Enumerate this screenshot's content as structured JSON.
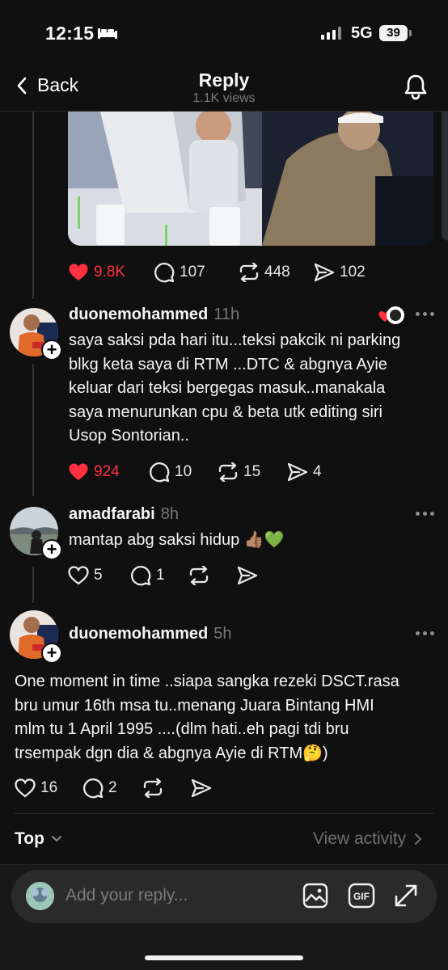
{
  "status_bar": {
    "time": "12:15",
    "network": "5G",
    "battery": "39"
  },
  "header": {
    "back_label": "Back",
    "title": "Reply",
    "views": "1.1K views"
  },
  "post_actions": {
    "likes": "9.8K",
    "comments": "107",
    "reposts": "448",
    "shares": "102"
  },
  "replies": [
    {
      "username": "duonemohammed",
      "time": "11h",
      "text": "saya saksi pda hari itu...teksi pakcik ni parking\nblkg keta saya di RTM ...DTC & abgnya Ayie\nkeluar dari teksi bergegas masuk..manakala\nsaya menurunkan cpu & beta utk editing siri\nUsop Sontorian..",
      "likes": "924",
      "comments": "10",
      "reposts": "15",
      "shares": "4"
    },
    {
      "username": "amadfarabi",
      "time": "8h",
      "text": "mantap abg saksi hidup 👍🏽💚",
      "likes": "5",
      "comments": "1",
      "reposts": "",
      "shares": ""
    },
    {
      "username": "duonemohammed",
      "time": "5h",
      "text": "One moment in time ..siapa sangka rezeki DSCT.rasa\nbru umur 16th msa tu..menang Juara Bintang HMI\nmlm tu 1 April 1995 ....(dlm hati..eh pagi tdi bru\ntrsempak dgn dia & abgnya Ayie di RTM🤔)",
      "likes": "16",
      "comments": "2",
      "reposts": "",
      "shares": ""
    }
  ],
  "footer": {
    "sort_label": "Top",
    "view_activity": "View activity"
  },
  "composer": {
    "placeholder": "Add your reply..."
  },
  "colors": {
    "background": "#101010",
    "like_red": "#ff3040",
    "muted": "#777777"
  },
  "icons": [
    "bed-icon",
    "signal-icon",
    "chevron-left-icon",
    "bell-icon",
    "heart-icon",
    "comment-icon",
    "repost-icon",
    "share-icon",
    "more-icon",
    "image-icon",
    "gif-icon",
    "expand-icon",
    "chevron-down-icon",
    "chevron-right-icon"
  ]
}
